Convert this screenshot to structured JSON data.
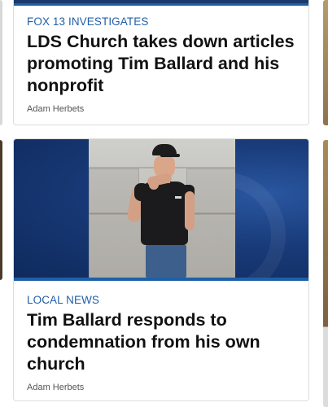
{
  "articles": [
    {
      "category": "FOX 13 INVESTIGATES",
      "headline": "LDS Church takes down articles promoting Tim Ballard and his nonprofit",
      "author": "Adam Herbets"
    },
    {
      "category": "LOCAL NEWS",
      "headline": "Tim Ballard responds to condemnation from his own church",
      "author": "Adam Herbets",
      "thumbnail": "photo"
    }
  ],
  "colors": {
    "accent_blue": "#1f5fa8",
    "headline": "#111111",
    "author": "#555555",
    "thumb_bg": "#183a78"
  }
}
